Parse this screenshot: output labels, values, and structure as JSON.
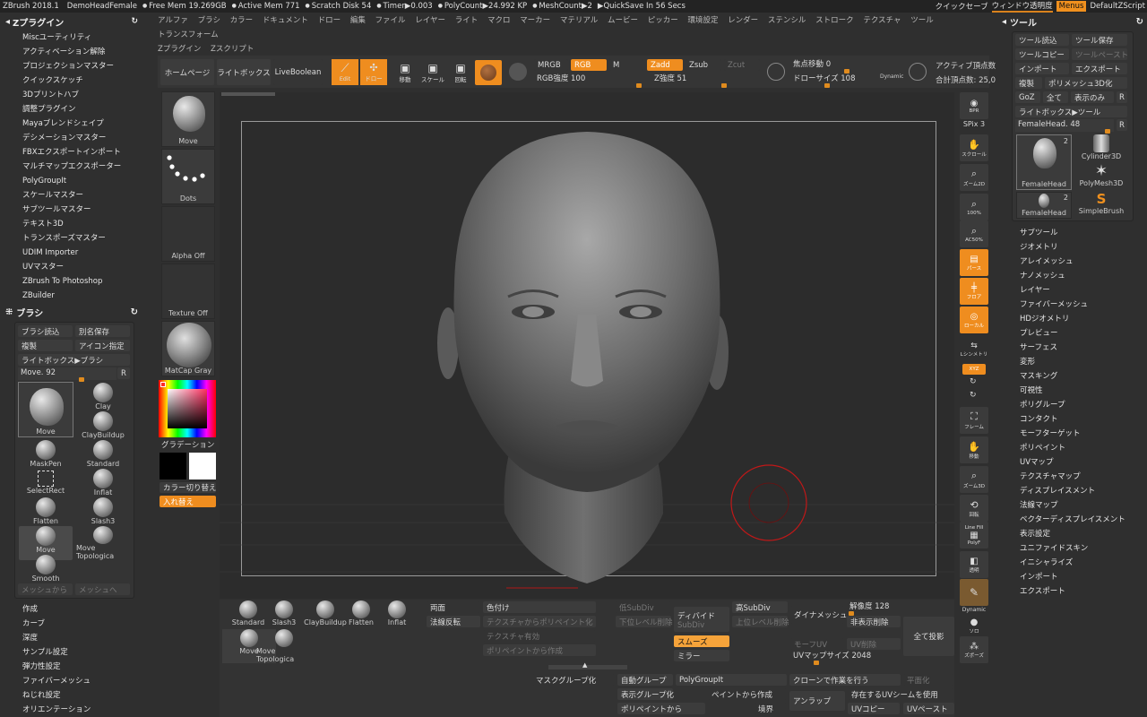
{
  "titlebar": {
    "app": "ZBrush 2018.1",
    "doc": "DemoHeadFemale",
    "stats": [
      "Free Mem 19.269GB",
      "Active Mem 771",
      "Scratch Disk 54",
      "Timer▶0.003",
      "PolyCount▶24.992 KP",
      "MeshCount▶2",
      "▶QuickSave In 56 Secs"
    ],
    "quicksave": "クイックセーブ",
    "transparency": "ウィンドウ透明度",
    "menus": "Menus",
    "script": "DefaultZScript"
  },
  "menubar": {
    "row1": [
      "アルファ",
      "ブラシ",
      "カラー",
      "ドキュメント",
      "ドロー",
      "編集",
      "ファイル",
      "レイヤー",
      "ライト",
      "マクロ",
      "マーカー",
      "マテリアル",
      "ムービー",
      "ピッカー",
      "環境設定",
      "レンダー",
      "ステンシル",
      "ストローク",
      "テクスチャ",
      "ツール",
      "トランスフォーム"
    ],
    "row2": [
      "Zプラグイン",
      "Zスクリプト"
    ]
  },
  "zplugin": {
    "title": "Zプラグイン",
    "items": [
      "Miscユーティリティ",
      "アクティベーション解除",
      "プロジェクションマスター",
      "クイックスケッチ",
      "3Dプリントハブ",
      "調整プラグイン",
      "Mayaブレンドシェイプ",
      "デシメーションマスター",
      "FBXエクスポートインポート",
      "マルチマップエクスポーター",
      "PolyGroupIt",
      "スケールマスター",
      "サブツールマスター",
      "テキスト3D",
      "トランスポーズマスター",
      "UDIM Importer",
      "UVマスター",
      "ZBrush To Photoshop",
      "ZBuilder"
    ]
  },
  "brush": {
    "title": "ブラシ",
    "load": "ブラシ読込",
    "saveas": "別名保存",
    "clone": "複製",
    "icon": "アイコン指定",
    "lightbox": "ライトボックス▶ブラシ",
    "current": "Move. 92",
    "r": "R",
    "grid": [
      "Move",
      "Clay",
      "ClayBuildup",
      "MaskPen",
      "Standard",
      "SelectRect",
      "Inflat",
      "Flatten",
      "Slash3",
      "Move",
      "Move Topologica",
      "Smooth"
    ],
    "from_mesh": "メッシュから",
    "to_mesh": "メッシュへ"
  },
  "bottom_left": [
    "作成",
    "カーブ",
    "深度",
    "サンプル設定",
    "弾力性設定",
    "ファイバーメッシュ",
    "ねじれ設定",
    "オリエンテーション"
  ],
  "toolbar": {
    "home": "ホームページ",
    "lightbox": "ライトボックス",
    "liveboolean": "LiveBoolean",
    "edit": "Edit",
    "draw": "ドロー",
    "move": "移動",
    "scale": "スケール",
    "rotate": "回転",
    "mrgb": "MRGB",
    "rgb": "RGB",
    "m": "M",
    "zadd": "Zadd",
    "zsub": "Zsub",
    "zcut": "Zcut",
    "rgb_int": "RGB強度 100",
    "z_int": "Z強度 51",
    "focal": "焦点移動 0",
    "draw_size": "ドローサイズ 108",
    "dynamic": "Dynamic",
    "active_pts": "アクティブ頂点数",
    "total_pts": "合計頂点数: 25,0"
  },
  "left_shelf": {
    "brush": "Move",
    "stroke": "Dots",
    "alpha": "Alpha Off",
    "texture": "Texture Off",
    "material": "MatCap Gray",
    "gradient": "グラデーション",
    "switch_color": "カラー切り替え",
    "swap": "入れ替え"
  },
  "right_tools": [
    {
      "icon": "bpr-icon",
      "label": "BPR"
    },
    {
      "icon": "spix",
      "label": "SPix 3"
    },
    {
      "icon": "scroll-icon",
      "label": "スクロール"
    },
    {
      "icon": "zoom2d-icon",
      "label": "ズーム2D"
    },
    {
      "icon": "100-icon",
      "label": "100%"
    },
    {
      "icon": "ac50-icon",
      "label": "AC50%"
    },
    {
      "icon": "persp-icon",
      "label": "パース"
    },
    {
      "icon": "floor-icon",
      "label": "フロア"
    },
    {
      "icon": "local-icon",
      "label": "ローカル"
    },
    {
      "icon": "lsym-icon",
      "label": "Lシンメトリ"
    },
    {
      "icon": "xyz-icon",
      "label": "XYZ"
    },
    {
      "icon": "frame-icon",
      "label": "フレーム"
    },
    {
      "icon": "move-icon",
      "label": "移動"
    },
    {
      "icon": "zoom3d-icon",
      "label": "ズーム3D"
    },
    {
      "icon": "rotate-icon",
      "label": "回転"
    },
    {
      "icon": "linefill-icon",
      "label": "Line Fill"
    },
    {
      "icon": "polyf",
      "label": "PolyF"
    },
    {
      "icon": "transp-icon",
      "label": "透明"
    },
    {
      "icon": "ghost-icon",
      "label": "ゴースト"
    },
    {
      "icon": "dynamic-icon",
      "label": "Dynamic"
    },
    {
      "icon": "solo-icon",
      "label": "ソロ"
    },
    {
      "icon": "xpose-icon",
      "label": "ズポーズ"
    }
  ],
  "tool": {
    "title": "ツール",
    "load": "ツール読込",
    "save": "ツール保存",
    "copy": "ツールコピー",
    "paste": "ツールペースト",
    "import": "インポート",
    "export": "エクスポート",
    "clone": "複製",
    "polymesh3d": "ポリメッシュ3D化",
    "goz": "GoZ",
    "all": "全て",
    "visible": "表示のみ",
    "r": "R",
    "lightbox": "ライトボックス▶ツール",
    "current": "FemaleHead. 48",
    "thumbs": [
      "FemaleHead",
      "Cylinder3D",
      "PolyMesh3D",
      "FemaleHead",
      "SimpleBrush"
    ],
    "badge": "2",
    "items": [
      "サブツール",
      "ジオメトリ",
      "アレイメッシュ",
      "ナノメッシュ",
      "レイヤー",
      "ファイバーメッシュ",
      "HDジオメトリ",
      "プレビュー",
      "サーフェス",
      "変形",
      "マスキング",
      "可視性",
      "ポリグループ",
      "コンタクト",
      "モーフターゲット",
      "ポリペイント",
      "UVマップ",
      "テクスチャマップ",
      "ディスプレイスメント",
      "法線マップ",
      "ベクターディスプレイスメント",
      "表示設定",
      "ユニファイドスキン",
      "イニシャライズ",
      "インポート",
      "エクスポート"
    ]
  },
  "bottom": {
    "brushes": [
      "Standard",
      "Slash3",
      "ClayBuildup",
      "Flatten",
      "Inflat",
      "Move",
      "Move Topologica"
    ],
    "double": "両面",
    "flip": "法線反転",
    "colorize": "色付け",
    "tex2poly": "テクスチャからポリペイント化",
    "tex_on": "テクスチャ有効",
    "poly2tex": "ポリペイントから作成",
    "lowsub": "低SubDiv",
    "del_lower": "下位レベル削除",
    "divide": "ディバイド",
    "subdiv": "SubDiv",
    "smooth": "スムーズ",
    "mirror": "ミラー",
    "highsub": "高SubDiv",
    "del_higher": "上位レベル削除",
    "dynamesh": "ダイナメッシュ",
    "resolution": "解像度 128",
    "del_hidden": "非表示削除",
    "project_all": "全て投影",
    "morph_uv": "モーフUV",
    "uv_delete": "UV削除",
    "uv_size": "UVマップサイズ 2048",
    "mask_group": "マスクグループ化",
    "auto_group": "自動グループ",
    "polygroupit": "PolyGroupIt",
    "clone_work": "クローンで作業を行う",
    "flatten_ui": "平面化",
    "visible_group": "表示グループ化",
    "from_paint": "ペイントから作成",
    "unwrap": "アンラップ",
    "use_seams": "存在するUVシームを使用",
    "polypaint_from": "ポリペイントから",
    "border": "境界",
    "uv_copy": "UVコピー",
    "uv_paste": "UVペースト"
  }
}
